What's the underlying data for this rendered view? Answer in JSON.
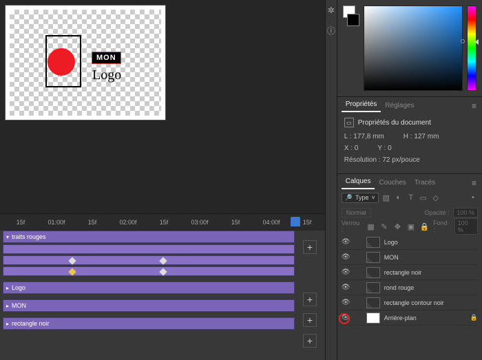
{
  "canvas": {
    "mon": "MON",
    "logo": "Logo"
  },
  "timeline": {
    "ruler": [
      "15f",
      "01:00f",
      "15f",
      "02:00f",
      "15f",
      "03:00f",
      "15f",
      "04:00f",
      "15f"
    ],
    "tracks": {
      "traits_rouges": "traits rouges",
      "logo": "Logo",
      "mon": "MON",
      "rect_noir": "rectangle noir"
    },
    "plus": "+"
  },
  "properties": {
    "tab_props": "Propriétés",
    "tab_reglages": "Réglages",
    "doc_props": "Propriétés du document",
    "L_label": "L :",
    "L_val": "177,8 mm",
    "H_label": "H :",
    "H_val": "127 mm",
    "X_label": "X :",
    "X_val": "0",
    "Y_label": "Y :",
    "Y_val": "0",
    "res_label": "Résolution :",
    "res_val": "72 px/pouce"
  },
  "layers_panel": {
    "tab_calques": "Calques",
    "tab_couches": "Couches",
    "tab_traces": "Tracés",
    "type_sel": "Type",
    "normal": "Normal",
    "opacity_label": "Opacité :",
    "opacity_val": "100 %",
    "verrou": "Verrou :",
    "fond_label": "Fond :",
    "fond_val": "100 %",
    "layers": [
      {
        "name": "Logo"
      },
      {
        "name": "MON"
      },
      {
        "name": "rectangle noir"
      },
      {
        "name": "rond rouge"
      },
      {
        "name": "rectangle contour noir"
      },
      {
        "name": "Arrière-plan"
      }
    ]
  }
}
